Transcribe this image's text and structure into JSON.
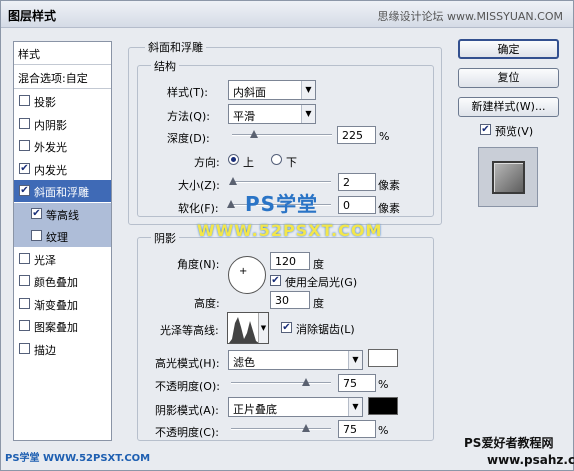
{
  "window": {
    "title": "图层样式",
    "watermark_top": "思缘设计论坛 www.MISSYUAN.COM"
  },
  "left_panel": {
    "header": "样式",
    "blend_options": "混合选项:自定",
    "items": [
      {
        "label": "投影",
        "checked": false
      },
      {
        "label": "内阴影",
        "checked": false
      },
      {
        "label": "外发光",
        "checked": false
      },
      {
        "label": "内发光",
        "checked": true
      },
      {
        "label": "斜面和浮雕",
        "checked": true,
        "selected": true
      },
      {
        "label": "等高线",
        "checked": true,
        "sub": true
      },
      {
        "label": "纹理",
        "checked": false,
        "sub": true
      },
      {
        "label": "光泽",
        "checked": false
      },
      {
        "label": "颜色叠加",
        "checked": false
      },
      {
        "label": "渐变叠加",
        "checked": false
      },
      {
        "label": "图案叠加",
        "checked": false
      },
      {
        "label": "描边",
        "checked": false
      }
    ]
  },
  "bevel": {
    "group_title": "斜面和浮雕",
    "structure_title": "结构",
    "style_label": "样式(T):",
    "style_value": "内斜面",
    "technique_label": "方法(Q):",
    "technique_value": "平滑",
    "depth_label": "深度(D):",
    "depth_value": "225",
    "depth_unit": "%",
    "depth_level": 0.22,
    "direction_label": "方向:",
    "direction_up": "上",
    "direction_down": "下",
    "size_label": "大小(Z):",
    "size_value": "2",
    "size_unit": "像素",
    "size_level": 0.02,
    "soften_label": "软化(F):",
    "soften_value": "0",
    "soften_unit": "像素",
    "soften_level": 0.0
  },
  "shading": {
    "title": "阴影",
    "angle_label": "角度(N):",
    "angle_value": "120",
    "angle_unit": "度",
    "global_light_label": "使用全局光(G)",
    "altitude_label": "高度:",
    "altitude_value": "30",
    "altitude_unit": "度",
    "gloss_contour_label": "光泽等高线:",
    "anti_aliased_label": "消除锯齿(L)",
    "highlight_mode_label": "高光模式(H):",
    "highlight_mode_value": "滤色",
    "highlight_color": "#ffffff",
    "highlight_opacity_label": "不透明度(O):",
    "highlight_opacity_value": "75",
    "highlight_opacity_unit": "%",
    "highlight_opacity_level": 0.75,
    "shadow_mode_label": "阴影模式(A):",
    "shadow_mode_value": "正片叠底",
    "shadow_color": "#000000",
    "shadow_opacity_label": "不透明度(C):",
    "shadow_opacity_value": "75",
    "shadow_opacity_unit": "%",
    "shadow_opacity_level": 0.75
  },
  "buttons": {
    "ok": "确定",
    "reset": "复位",
    "new_style": "新建样式(W)...",
    "preview_label": "预览(V)"
  },
  "watermarks": {
    "center_title": "PS学堂",
    "center_url": "WWW.52PSXT.COM",
    "bottom_left": "PS学堂 WWW.52PSXT.COM",
    "bottom_right_title": "PS爱好者教程网",
    "bottom_right_url": "www.psahz.com"
  },
  "colors": {
    "selection": "#3f6ab6",
    "watermark_blue": "#2c84c8"
  }
}
